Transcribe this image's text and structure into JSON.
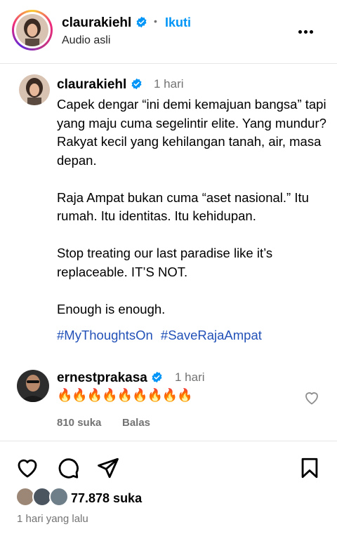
{
  "header": {
    "username": "claurakiehl",
    "verified_icon": "verified-badge-icon",
    "separator": "•",
    "follow_label": "Ikuti",
    "subtitle": "Audio asli",
    "more_icon": "more-options-icon"
  },
  "caption": {
    "username": "claurakiehl",
    "time": "1 hari",
    "paragraphs": [
      "Capek dengar “ini demi kemajuan bangsa” tapi yang maju cuma segelintir elite. Yang mundur? Rakyat kecil yang kehilangan tanah, air, masa depan.",
      "Raja Ampat bukan cuma “aset nasional.” Itu rumah. Itu identitas. Itu kehidupan.",
      "Stop treating our last paradise like it’s replaceable. IT’S NOT.",
      "Enough is enough."
    ],
    "hashtags": [
      "#MyThoughtsOn",
      "#SaveRajaAmpat"
    ]
  },
  "comment": {
    "username": "ernestprakasa",
    "time": "1 hari",
    "text": "🔥🔥🔥🔥🔥🔥🔥🔥🔥",
    "likes": "810 suka",
    "reply_label": "Balas"
  },
  "actions": {
    "like_icon": "heart-icon",
    "comment_icon": "comment-icon",
    "share_icon": "share-icon",
    "save_icon": "bookmark-icon"
  },
  "footer": {
    "likes": "77.878 suka",
    "posted": "1 hari yang lalu"
  },
  "colors": {
    "link": "#0095f6",
    "hashtag": "#2251b8",
    "muted": "#737373",
    "verified": "#0095f6"
  }
}
